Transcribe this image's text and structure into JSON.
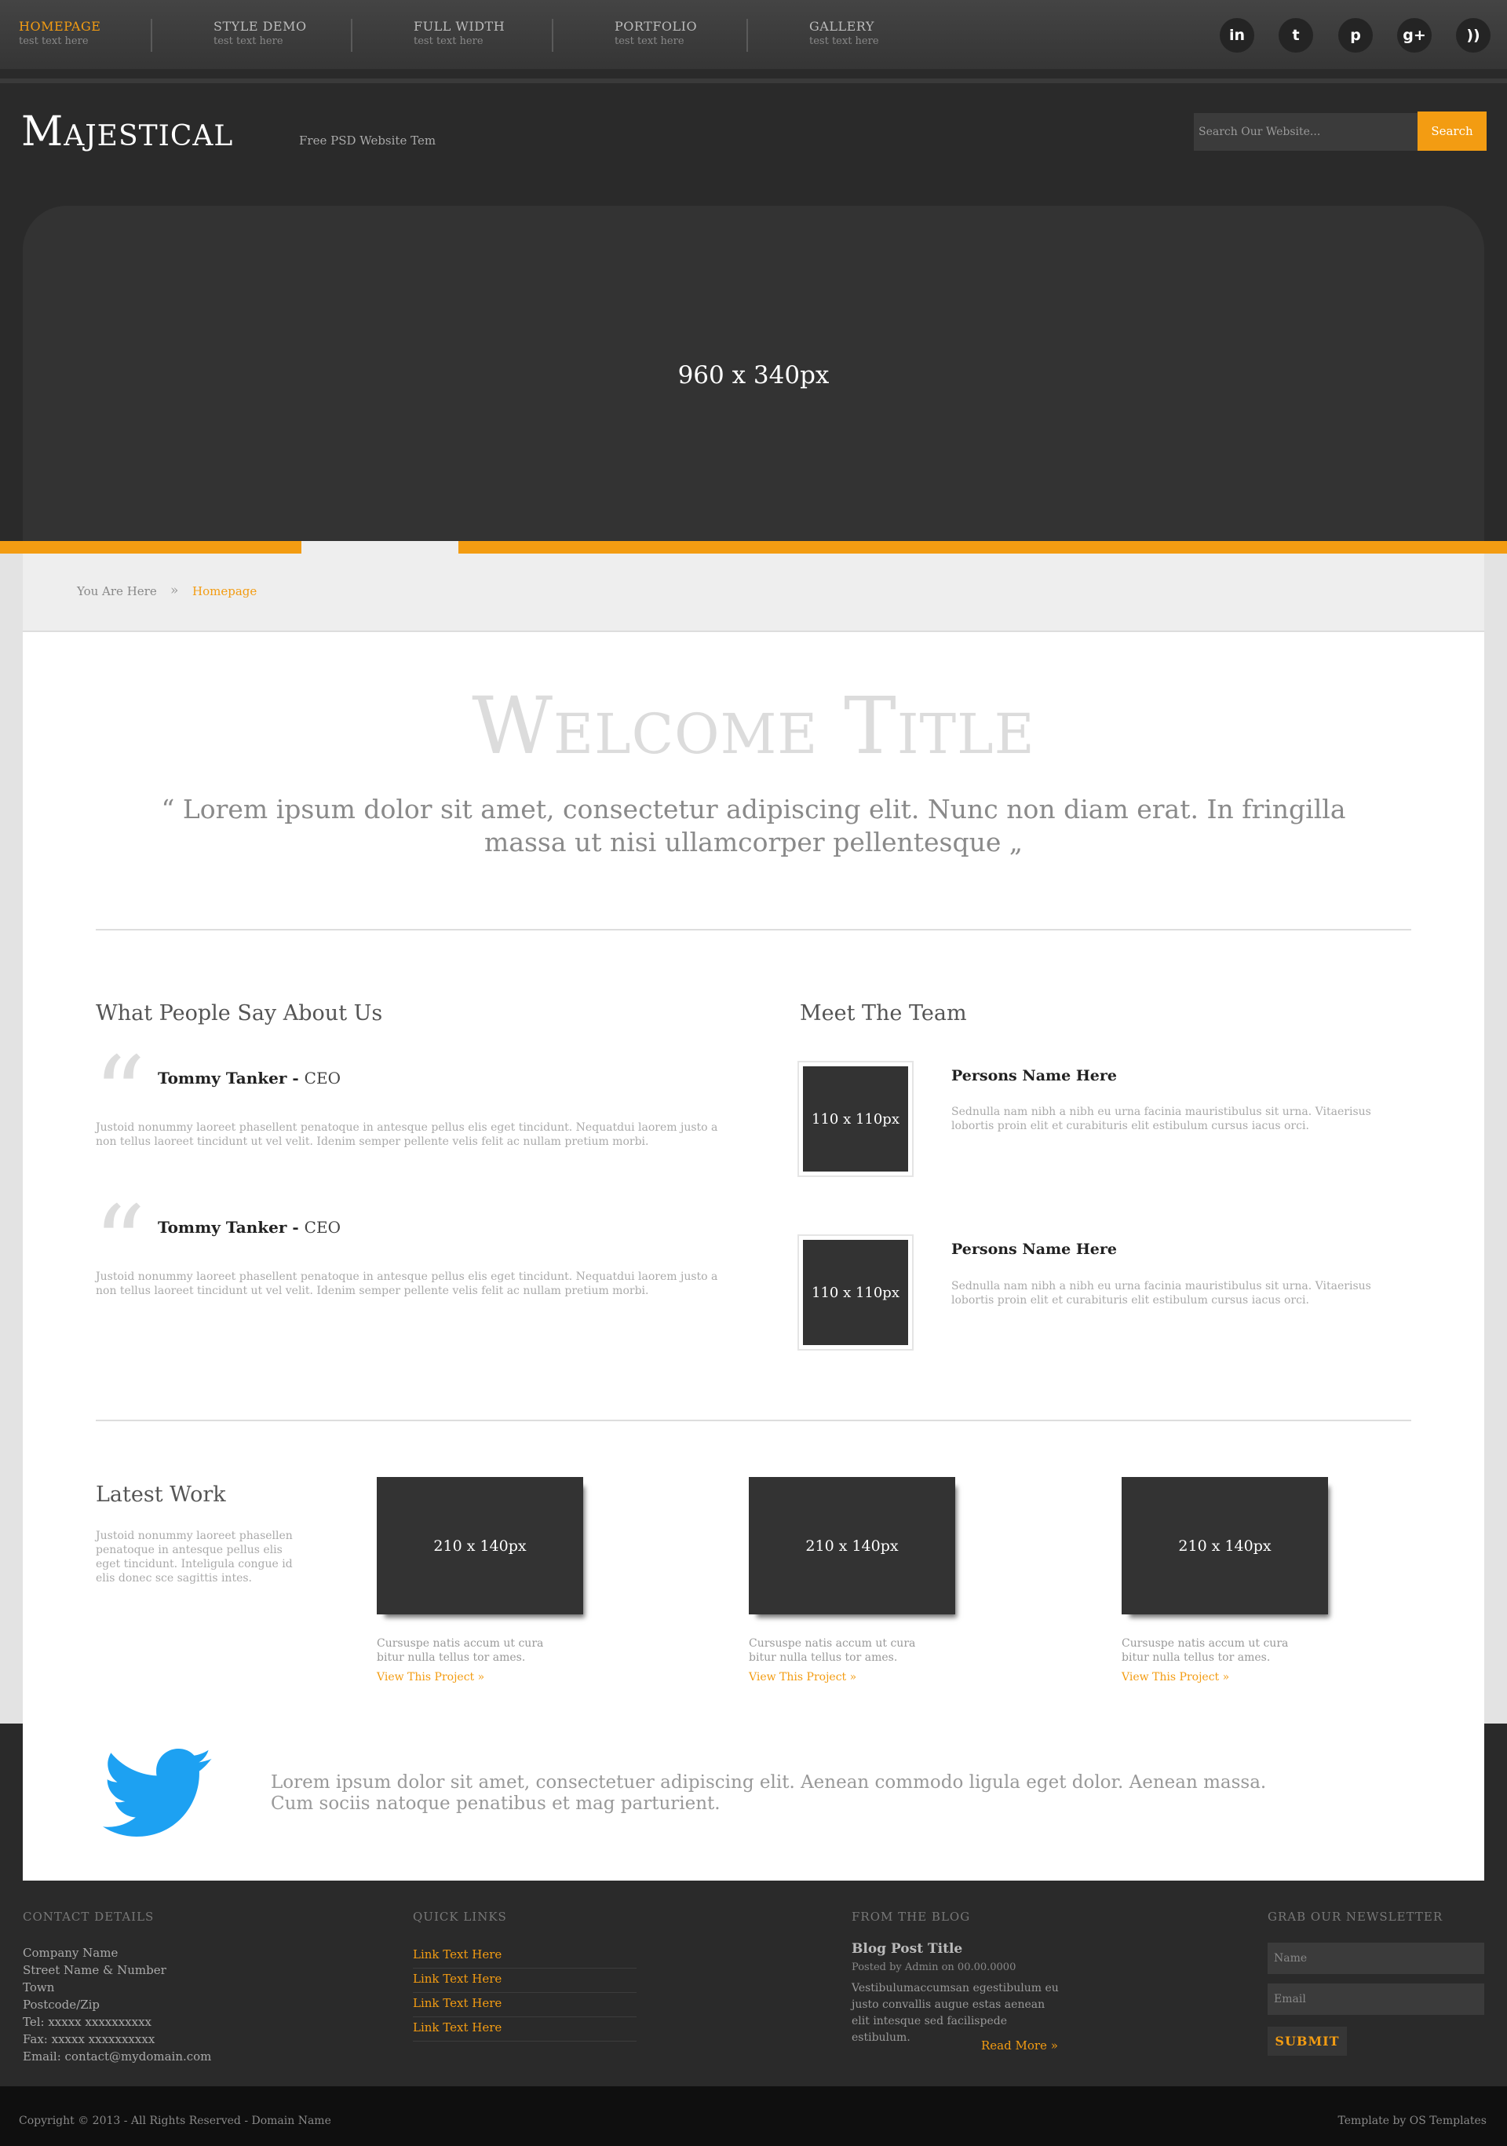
{
  "nav": {
    "items": [
      {
        "label": "HOMEPAGE",
        "sub": "test text here"
      },
      {
        "label": "STYLE DEMO",
        "sub": "test text here"
      },
      {
        "label": "FULL WIDTH",
        "sub": "test text here"
      },
      {
        "label": "PORTFOLIO",
        "sub": "test text here"
      },
      {
        "label": "GALLERY",
        "sub": "test text here"
      }
    ],
    "social": [
      {
        "icon": "linkedin-icon",
        "glyph": "in"
      },
      {
        "icon": "twitter-icon",
        "glyph": "t"
      },
      {
        "icon": "pinterest-icon",
        "glyph": "p"
      },
      {
        "icon": "google-plus-icon",
        "glyph": "g+"
      },
      {
        "icon": "rss-icon",
        "glyph": "))"
      }
    ]
  },
  "header": {
    "logo": "Majestical",
    "tagline": "Free PSD Website Tem",
    "search_placeholder": "Search Our Website...",
    "search_button": "Search"
  },
  "slider": {
    "caption": "960 x 340px"
  },
  "breadcrumb": {
    "label": "You Are Here",
    "separator": "»",
    "current": "Homepage"
  },
  "welcome": {
    "title": "Welcome Title",
    "quote": "“ Lorem ipsum dolor sit amet, consectetur adipiscing elit. Nunc non diam erat. In fringilla massa ut nisi ullamcorper pellentesque „"
  },
  "testimonials": {
    "title": "What People Say About Us",
    "items": [
      {
        "name": "Tommy Tanker",
        "role": "CEO",
        "text": "Justoid nonummy laoreet phasellent penatoque in antesque pellus elis eget tincidunt. Nequatdui laorem justo a non tellus laoreet tincidunt ut vel velit. Idenim semper pellente velis felit ac nullam pretium morbi."
      },
      {
        "name": "Tommy Tanker",
        "role": "CEO",
        "text": "Justoid nonummy laoreet phasellent penatoque in antesque pellus elis eget tincidunt. Nequatdui laorem justo a non tellus laoreet tincidunt ut vel velit. Idenim semper pellente velis felit ac nullam pretium morbi."
      }
    ]
  },
  "team": {
    "title": "Meet The Team",
    "members": [
      {
        "photo": "110 x 110px",
        "name": "Persons Name Here",
        "text": "Sednulla nam nibh a nibh eu urna facinia mauristibulus sit urna. Vitaerisus lobortis proin elit et curabituris elit estibulum cursus iacus orci."
      },
      {
        "photo": "110 x 110px",
        "name": "Persons Name Here",
        "text": "Sednulla nam nibh a nibh eu urna facinia mauristibulus sit urna. Vitaerisus lobortis proin elit et curabituris elit estibulum cursus iacus orci."
      }
    ]
  },
  "latest_work": {
    "title": "Latest Work",
    "description": "Justoid nonummy laoreet phasellen penatoque in antesque pellus elis eget tincidunt. Inteligula congue id elis donec sce sagittis intes.",
    "items": [
      {
        "thumb": "210 x 140px",
        "text": "Cursuspe natis accum ut cura bitur nulla tellus tor ames.",
        "link": "View This Project »"
      },
      {
        "thumb": "210 x 140px",
        "text": "Cursuspe natis accum ut cura bitur nulla tellus tor ames.",
        "link": "View This Project »"
      },
      {
        "thumb": "210 x 140px",
        "text": "Cursuspe natis accum ut cura bitur nulla tellus tor ames.",
        "link": "View This Project »"
      }
    ]
  },
  "twitter": {
    "text": "Lorem ipsum dolor sit amet, consectetuer adipiscing elit. Aenean commodo ligula eget dolor. Aenean massa. Cum sociis natoque penatibus et mag parturient."
  },
  "footer": {
    "contact": {
      "heading": "CONTACT DETAILS",
      "lines": [
        "Company Name",
        "Street Name & Number",
        "Town",
        "Postcode/Zip",
        "Tel: xxxxx xxxxxxxxxx",
        "Fax: xxxxx xxxxxxxxxx",
        "Email: contact@mydomain.com"
      ]
    },
    "quick_links": {
      "heading": "QUICK LINKS",
      "links": [
        "Link Text Here",
        "Link Text Here",
        "Link Text Here",
        "Link Text Here"
      ]
    },
    "blog": {
      "heading": "FROM THE BLOG",
      "post_title": "Blog Post Title",
      "meta": "Posted by Admin on 00.00.0000",
      "text": "Vestibulumaccumsan egestibulum eu justo convallis augue estas aenean elit intesque sed facilispede estibulum.",
      "read_more": "Read More »"
    },
    "newsletter": {
      "heading": "GRAB OUR NEWSLETTER",
      "name_placeholder": "Name",
      "email_placeholder": "Email",
      "submit": "SUBMIT"
    },
    "copyright": "Copyright © 2013 - All Rights Reserved - Domain Name",
    "template_by": "Template by OS Templates"
  },
  "colors": {
    "accent": "#f39c12",
    "dark": "#2a2a2a",
    "twitter": "#1da1f2"
  }
}
